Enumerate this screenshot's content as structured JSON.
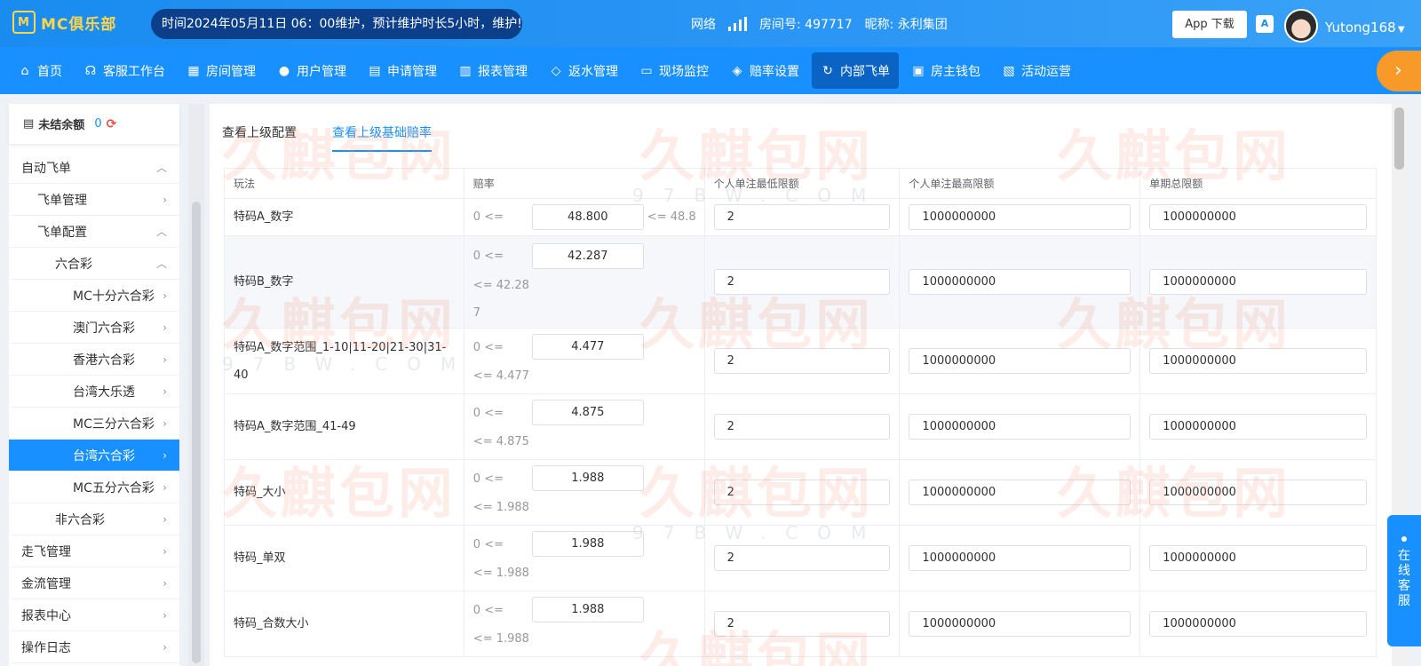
{
  "header": {
    "logo": "MC俱乐部",
    "notice": "时间2024年05月11日 06：00维护，预计维护时长5小时，维护!",
    "network_label": "网络",
    "room_label": "房间号: 497717",
    "nickname_label": "昵称: 永利集团",
    "app_download": "App 下载",
    "username": "Yutong168"
  },
  "nav": {
    "items": [
      {
        "label": "首页",
        "icon": "home-icon"
      },
      {
        "label": "客服工作台",
        "icon": "headset-icon"
      },
      {
        "label": "房间管理",
        "icon": "grid-icon"
      },
      {
        "label": "用户管理",
        "icon": "user-icon"
      },
      {
        "label": "申请管理",
        "icon": "document-icon"
      },
      {
        "label": "报表管理",
        "icon": "bar-chart-icon"
      },
      {
        "label": "返水管理",
        "icon": "tag-icon"
      },
      {
        "label": "现场监控",
        "icon": "monitor-icon"
      },
      {
        "label": "赔率设置",
        "icon": "shield-icon"
      },
      {
        "label": "内部飞单",
        "icon": "refresh-icon",
        "active": true
      },
      {
        "label": "房主钱包",
        "icon": "wallet-icon"
      },
      {
        "label": "活动运营",
        "icon": "calendar-icon"
      }
    ]
  },
  "sidebar": {
    "balance_label": "未结余额",
    "balance_value": "0",
    "items": [
      {
        "label": "自动飞单",
        "level": 0,
        "arrow": "up"
      },
      {
        "label": "飞单管理",
        "level": 1,
        "arrow": "right"
      },
      {
        "label": "飞单配置",
        "level": 1,
        "arrow": "up"
      },
      {
        "label": "六合彩",
        "level": 2,
        "arrow": "up"
      },
      {
        "label": "MC十分六合彩",
        "level": 3,
        "arrow": "right"
      },
      {
        "label": "澳门六合彩",
        "level": 3,
        "arrow": "right"
      },
      {
        "label": "香港六合彩",
        "level": 3,
        "arrow": "right"
      },
      {
        "label": "台湾大乐透",
        "level": 3,
        "arrow": "right"
      },
      {
        "label": "MC三分六合彩",
        "level": 3,
        "arrow": "right"
      },
      {
        "label": "台湾六合彩",
        "level": 3,
        "arrow": "right",
        "active": true
      },
      {
        "label": "MC五分六合彩",
        "level": 3,
        "arrow": "right"
      },
      {
        "label": "非六合彩",
        "level": 2,
        "arrow": "right"
      },
      {
        "label": "走飞管理",
        "level": 0,
        "arrow": "right"
      },
      {
        "label": "金流管理",
        "level": 0,
        "arrow": "right"
      },
      {
        "label": "报表中心",
        "level": 0,
        "arrow": "right"
      },
      {
        "label": "操作日志",
        "level": 0,
        "arrow": "right"
      }
    ]
  },
  "tabs": [
    {
      "label": "查看上级配置",
      "active": false
    },
    {
      "label": "查看上级基础赔率",
      "active": true
    }
  ],
  "table": {
    "headers": [
      "玩法",
      "赔率",
      "个人单注最低限额",
      "个人单注最高限额",
      "单期总限额"
    ],
    "rows": [
      {
        "game": "特码A_数字",
        "min_prefix": "0 <=",
        "odds": "48.800",
        "max_suffix": "<= 48.8",
        "min_bet": "2",
        "max_bet": "1000000000",
        "period_limit": "1000000000"
      },
      {
        "game": "特码B_数字",
        "min_prefix": "0 <=",
        "odds": "42.287",
        "max_suffix": "<= 42.287",
        "min_bet": "2",
        "max_bet": "1000000000",
        "period_limit": "1000000000"
      },
      {
        "game": "特码A_数字范围_1-10|11-20|21-30|31-40",
        "min_prefix": "0 <=",
        "odds": "4.477",
        "max_suffix": "<= 4.477",
        "min_bet": "2",
        "max_bet": "1000000000",
        "period_limit": "1000000000"
      },
      {
        "game": "特码A_数字范围_41-49",
        "min_prefix": "0 <=",
        "odds": "4.875",
        "max_suffix": "<= 4.875",
        "min_bet": "2",
        "max_bet": "1000000000",
        "period_limit": "1000000000"
      },
      {
        "game": "特码_大小",
        "min_prefix": "0 <=",
        "odds": "1.988",
        "max_suffix": "<= 1.988",
        "min_bet": "2",
        "max_bet": "1000000000",
        "period_limit": "1000000000"
      },
      {
        "game": "特码_单双",
        "min_prefix": "0 <=",
        "odds": "1.988",
        "max_suffix": "<= 1.988",
        "min_bet": "2",
        "max_bet": "1000000000",
        "period_limit": "1000000000"
      },
      {
        "game": "特码_合数大小",
        "min_prefix": "0 <=",
        "odds": "1.988",
        "max_suffix": "<= 1.988",
        "min_bet": "2",
        "max_bet": "1000000000",
        "period_limit": "1000000000"
      }
    ]
  },
  "watermark": {
    "text": "久麒包网",
    "sub": "97BW.COM"
  },
  "service": {
    "label": "在线客服"
  }
}
